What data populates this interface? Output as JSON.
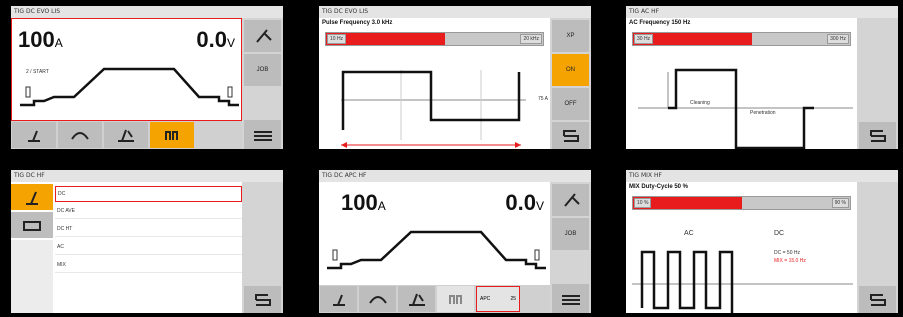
{
  "panels": {
    "p1": {
      "title": "TIG DC EVO LIS",
      "current": "100",
      "current_unit": "A",
      "voltage": "0.0",
      "voltage_unit": "V",
      "start_label": "2 / START",
      "side_job": "JOB"
    },
    "p2": {
      "title": "TIG DC EVO LIS",
      "heading": "Pulse Frequency 3.0 kHz",
      "min_label": "10 Hz",
      "max_label": "20 kHz",
      "fill_fraction": 0.55,
      "side_xp": "XP",
      "side_on": "ON",
      "side_off": "OFF",
      "axis_value": "75 A"
    },
    "p3": {
      "title": "TIG AC HF",
      "heading": "AC Frequency 150 Hz",
      "min_label": "30 Hz",
      "max_label": "300 Hz",
      "fill_fraction": 0.55,
      "label_cleaning": "Cleaning",
      "label_penetration": "Penetration"
    },
    "p4": {
      "title": "TIG DC HF",
      "items": [
        "DC",
        "DC AVE",
        "DC HT",
        "AC",
        "MIX"
      ],
      "selected_index": 0
    },
    "p5": {
      "title": "TIG DC APC HF",
      "current": "100",
      "current_unit": "A",
      "voltage": "0.0",
      "voltage_unit": "V",
      "side_job": "JOB",
      "apc_label": "APC",
      "apc_value": "25"
    },
    "p6": {
      "title": "TIG MIX HF",
      "heading": "MIX Duty-Cycle 50 %",
      "min_label": "10 %",
      "max_label": "90 %",
      "fill_fraction": 0.5,
      "label_ac": "AC",
      "label_dc": "DC",
      "note1": "DC = 50 Hz",
      "note2": "MIX = 15.0 Hz"
    }
  },
  "colors": {
    "accent": "#f5a300",
    "red": "#e81c1c"
  }
}
